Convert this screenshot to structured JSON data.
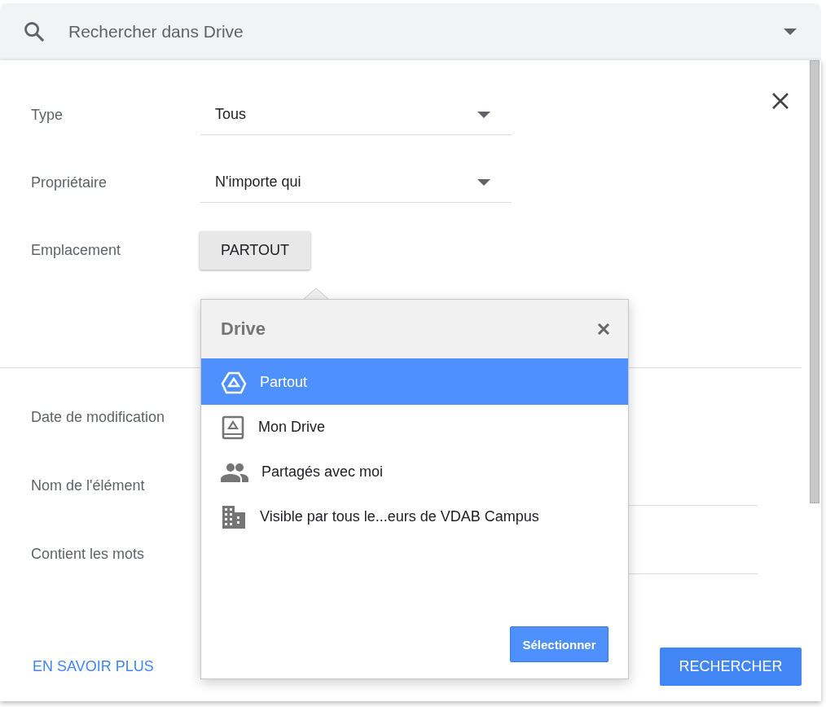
{
  "search": {
    "placeholder": "Rechercher dans Drive"
  },
  "filters": [
    {
      "kind": "select",
      "label": "Type",
      "value": "Tous"
    },
    {
      "kind": "select",
      "label": "Propriétaire",
      "value": "N'importe qui"
    },
    {
      "kind": "button",
      "label": "Emplacement",
      "value": "PARTOUT"
    }
  ],
  "more_filters": [
    {
      "kind": "label",
      "label": "Date de modification"
    },
    {
      "kind": "text",
      "label": "Nom de l'élément"
    },
    {
      "kind": "text",
      "label": "Contient les mots"
    }
  ],
  "footer": {
    "link": "EN SAVOIR PLUS",
    "button": "RECHERCHER"
  },
  "location_popup": {
    "title": "Drive",
    "items": [
      {
        "kind": "drive",
        "label": "Partout",
        "selected": true
      },
      {
        "kind": "my-drive",
        "label": "Mon Drive",
        "selected": false
      },
      {
        "kind": "shared",
        "label": "Partagés avec moi",
        "selected": false
      },
      {
        "kind": "domain",
        "label": "Visible par tous le...eurs de VDAB Campus",
        "selected": false
      }
    ],
    "button": "Sélectionner"
  }
}
